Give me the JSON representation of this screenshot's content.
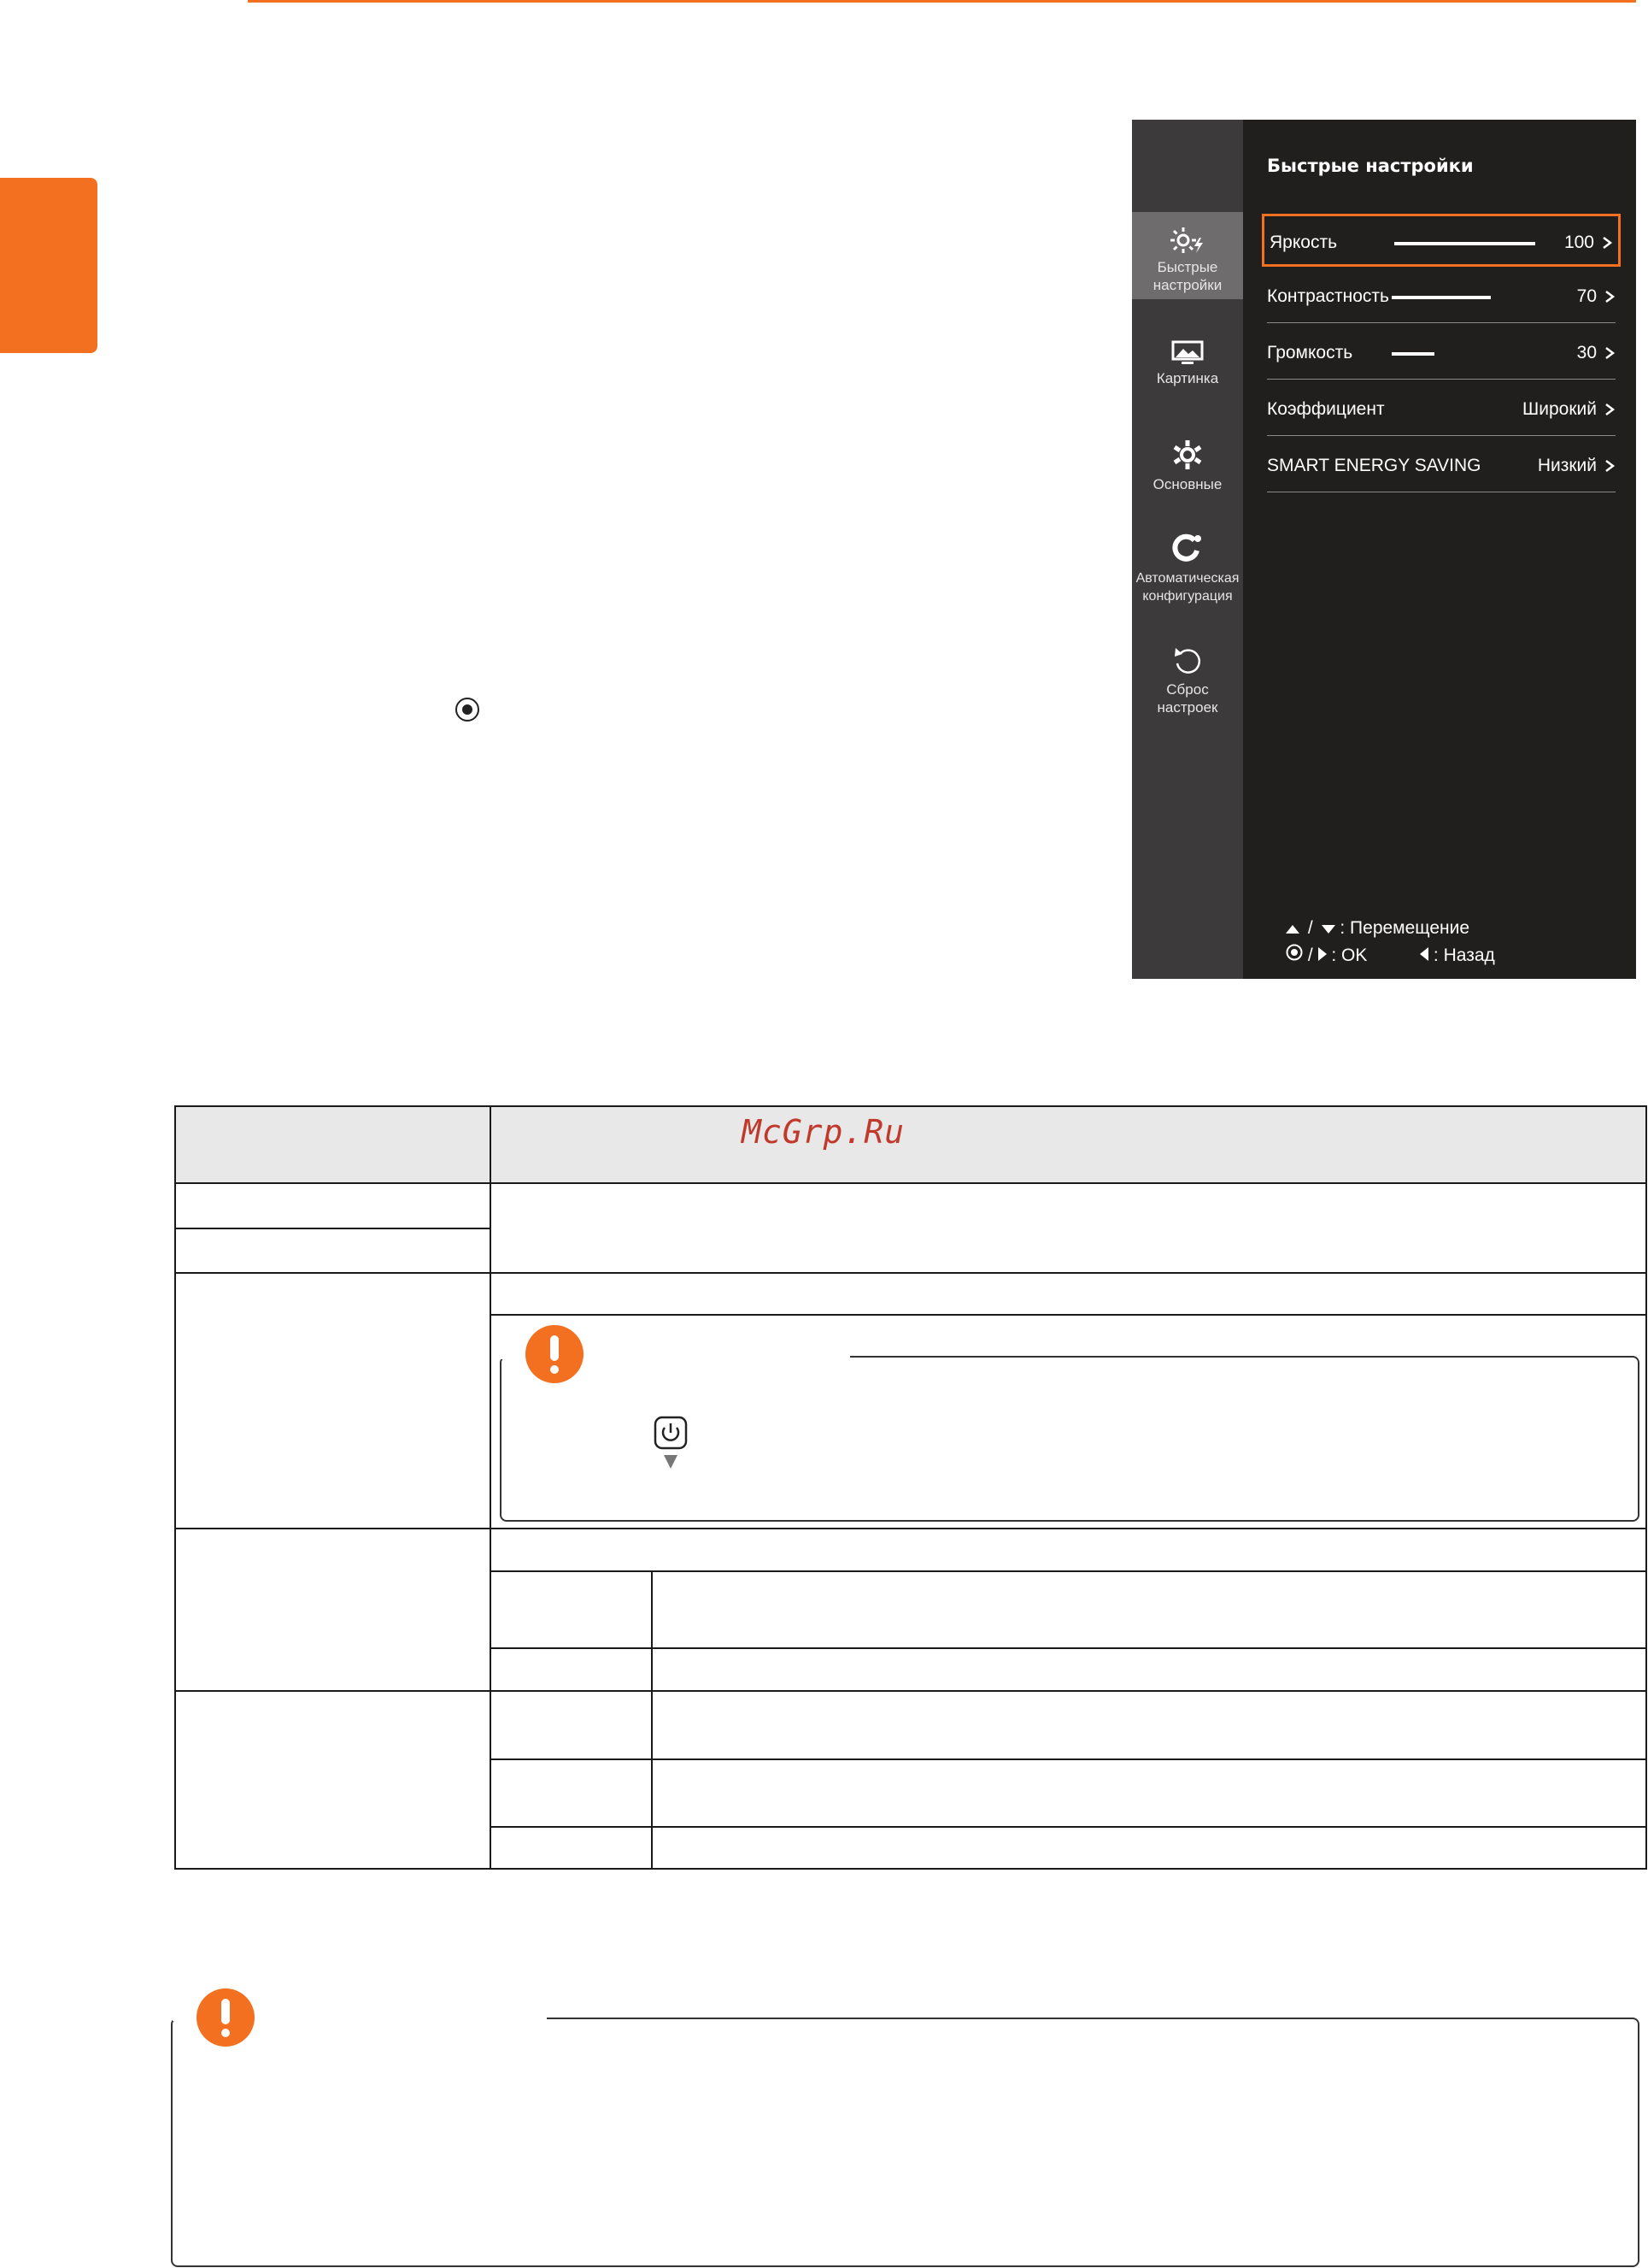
{
  "osd": {
    "title": "Быстрые настройки",
    "sidebar": [
      {
        "label_line1": "Быстрые",
        "label_line2": "настройки",
        "icon": "quick-settings-icon"
      },
      {
        "label_line1": "Картинка",
        "label_line2": "",
        "icon": "picture-icon"
      },
      {
        "label_line1": "Основные",
        "label_line2": "",
        "icon": "gear-icon"
      },
      {
        "label_line1": "Автоматическая",
        "label_line2": "конфигурация",
        "icon": "auto-config-icon"
      },
      {
        "label_line1": "Сброс",
        "label_line2": "настроек",
        "icon": "reset-icon"
      }
    ],
    "items": [
      {
        "label": "Яркость",
        "value": "100",
        "level": 100
      },
      {
        "label": "Контрастность",
        "value": "70",
        "level": 70
      },
      {
        "label": "Громкость",
        "value": "30",
        "level": 30
      },
      {
        "label": "Коэффициент",
        "value": "Широкий"
      },
      {
        "label": "SMART ENERGY SAVING",
        "value": "Низкий"
      }
    ],
    "help": {
      "move_label": ": Перемещение",
      "ok_label": ": OK",
      "back_label": ": Назад"
    },
    "colors": {
      "accent": "#f37021",
      "background": "#211e1e",
      "sidebar": "#3c3a3a"
    }
  },
  "table": {
    "watermark": "McGrp.Ru",
    "header_bg": "#e8e8e8"
  },
  "icons": {
    "ok_button": "ok-button-icon",
    "power_button": "power-button-icon",
    "warning": "warning-icon"
  }
}
